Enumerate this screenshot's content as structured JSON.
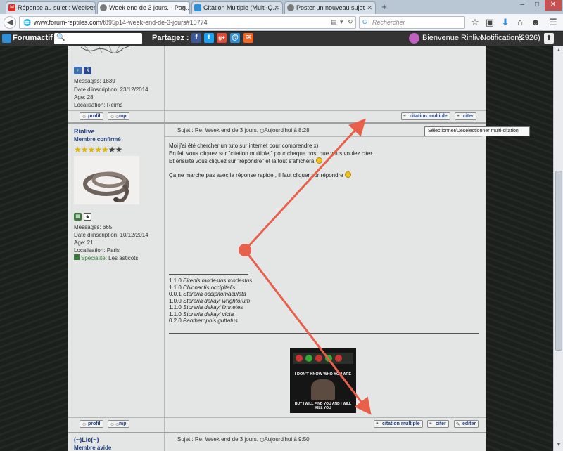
{
  "browser": {
    "tabs": [
      {
        "label": "Réponse au sujet : Week en...",
        "favicon": "gmail-icon",
        "favicon_text": "M",
        "favicon_color": "#d93025"
      },
      {
        "label": "Week end de 3 jours. - Pag...",
        "favicon": "forum-icon",
        "favicon_text": "",
        "favicon_color": "#7a7a7a"
      },
      {
        "label": "Citation Multiple (Multi-Q...",
        "favicon": "forumactif-icon",
        "favicon_text": "",
        "favicon_color": "#2f8fd4"
      },
      {
        "label": "Poster un nouveau sujet",
        "favicon": "forum-icon",
        "favicon_text": "",
        "favicon_color": "#7a7a7a"
      }
    ],
    "url": "www.forum-reptiles.com/t895p14-week-end-de-3-jours#10774",
    "url_host": "www.forum-reptiles.com",
    "url_path": "/t895p14-week-end-de-3-jours#10774",
    "search_placeholder": "Rechercher"
  },
  "toolbar": {
    "brand": "Forumactif",
    "share_label": "Partagez :",
    "welcome": "Bienvenue Rinlive",
    "notifications_label": "Notifications",
    "notifications_count": "(2926)"
  },
  "post1": {
    "messages": "Messages: 1839",
    "inscription": "Date d'inscription: 23/12/2014",
    "age": "Age: 28",
    "localisation": "Localisation: Reims",
    "btn_profil": "profil",
    "btn_mp": "mp",
    "btn_multi": "citation multiple",
    "btn_citer": "citer"
  },
  "tooltip": "Sélectionner/Désélectionner multi-citation",
  "post2": {
    "username": "Rinlive",
    "rank": "Membre confirmé",
    "stars_filled": 5,
    "stars_total": 7,
    "subject": "Sujet : Re: Week end de 3 jours.",
    "date": "Aujourd'hui à 8:28",
    "body": [
      "Moi j'ai été chercher un tuto sur internet pour comprendre x)",
      "En fait vous cliquez sur \"citation multiple \" pour chaque post que vous voulez citer.",
      "Et ensuite vous cliquez sur \"répondre\" et là tout s'affichera",
      "Ça ne marche pas avec la réponse rapide , il faut cliquer sur répondre"
    ],
    "signature": [
      {
        "code": "1.1.0",
        "name": "Eirenis modestus modestus"
      },
      {
        "code": "1.1.0",
        "name": "Chionactis occipitalis"
      },
      {
        "code": "0.0.1",
        "name": "Storeria occipitomaculata"
      },
      {
        "code": "1.0.0",
        "name": "Storeria dekayi wrightorum"
      },
      {
        "code": "1.1.0",
        "name": "Storeria dekayi limnetes"
      },
      {
        "code": "1.1.0",
        "name": "Storeria dekayi victa"
      },
      {
        "code": "0.2.0",
        "name": "Pantherophis guttatus"
      }
    ],
    "meme_top": "I DON'T KNOW WHO YOU ARE",
    "meme_bottom": "BUT I WILL FIND YOU AND I WILL KILL YOU",
    "messages": "Messages: 665",
    "inscription": "Date d'inscription: 10/12/2014",
    "age": "Age: 21",
    "localisation": "Localisation: Paris",
    "specialite_label": "Spécialité:",
    "specialite_value": "Les asticots",
    "btn_profil": "profil",
    "btn_mp": "mp",
    "btn_multi": "citation multiple",
    "btn_citer": "citer",
    "btn_editer": "editer"
  },
  "post3": {
    "username": "(~)Lic(~)",
    "rank": "Membre avide",
    "subject": "Sujet : Re: Week end de 3 jours.",
    "date": "Aujourd'hui à 9:50"
  },
  "colors": {
    "annotation": "#e8604a",
    "link_blue": "#1f3f80",
    "toolbar_bg": "#333333"
  }
}
